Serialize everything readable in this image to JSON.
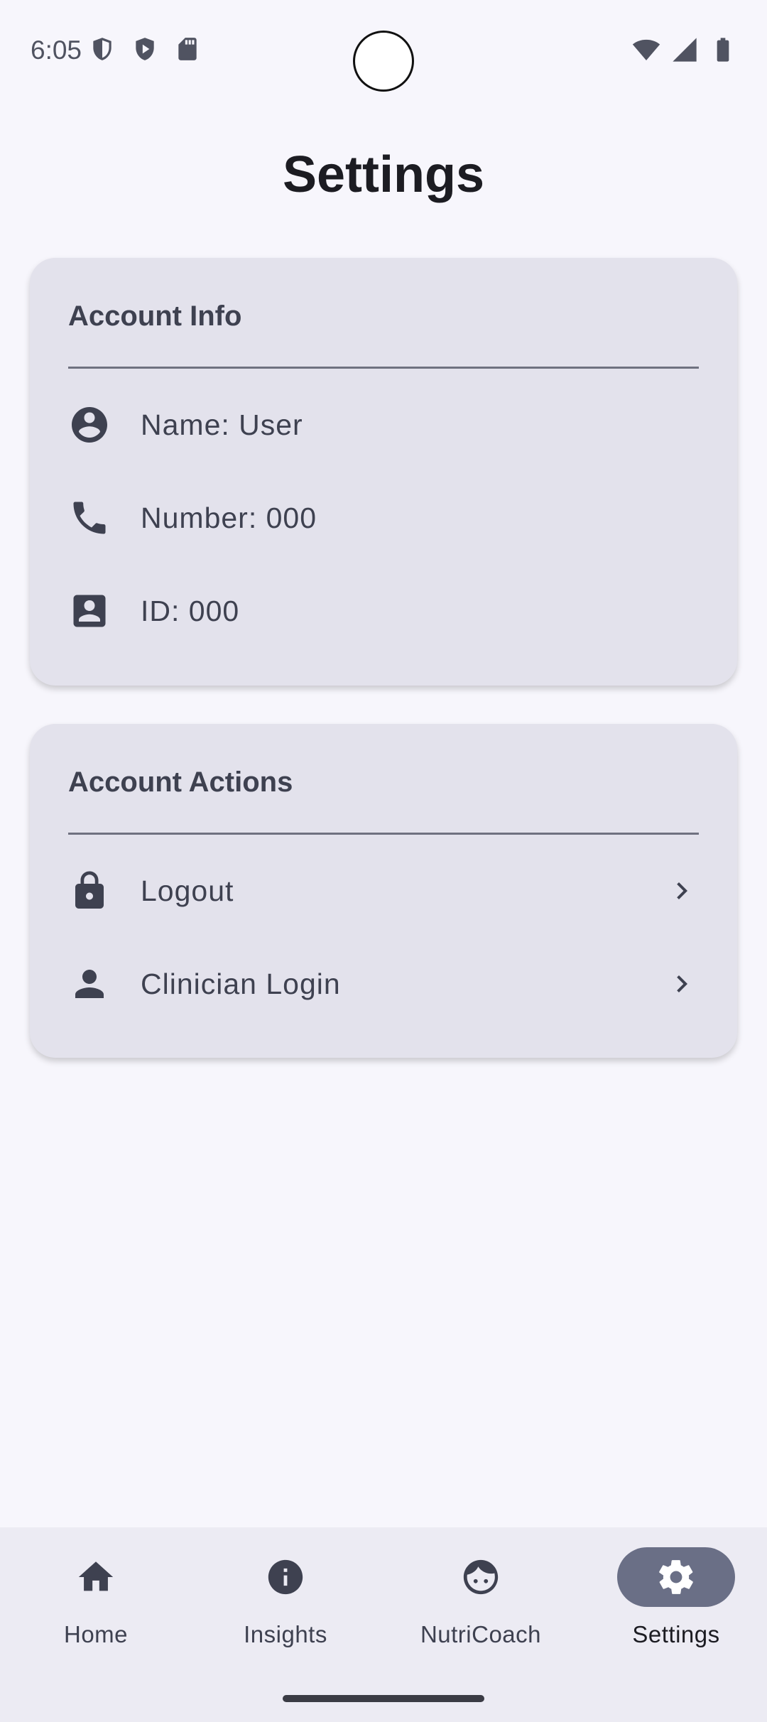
{
  "status_bar": {
    "time": "6:05",
    "left_icons": [
      "shield-outline-icon",
      "play-shield-icon",
      "sd-card-icon"
    ],
    "right_icons": [
      "wifi-icon",
      "cellular-signal-icon",
      "battery-icon"
    ]
  },
  "page": {
    "title": "Settings"
  },
  "account_info": {
    "header": "Account Info",
    "rows": [
      {
        "icon": "account-circle-icon",
        "label": "Name: User"
      },
      {
        "icon": "phone-icon",
        "label": "Number: 000"
      },
      {
        "icon": "contact-card-icon",
        "label": "ID: 000"
      }
    ]
  },
  "account_actions": {
    "header": "Account Actions",
    "rows": [
      {
        "icon": "lock-icon",
        "label": "Logout",
        "chevron": "chevron-right-icon"
      },
      {
        "icon": "person-icon",
        "label": "Clinician Login",
        "chevron": "chevron-right-icon"
      }
    ]
  },
  "bottom_nav": {
    "items": [
      {
        "icon": "home-icon",
        "label": "Home",
        "active": false
      },
      {
        "icon": "info-icon",
        "label": "Insights",
        "active": false
      },
      {
        "icon": "face-icon",
        "label": "NutriCoach",
        "active": false
      },
      {
        "icon": "gear-icon",
        "label": "Settings",
        "active": true
      }
    ]
  },
  "colors": {
    "background": "#f7f6fc",
    "card": "#e3e2ec",
    "text": "#3e4150",
    "title": "#1c1c22",
    "nav_active_pill": "#6a6f86",
    "nav_background": "#ecebf3"
  }
}
